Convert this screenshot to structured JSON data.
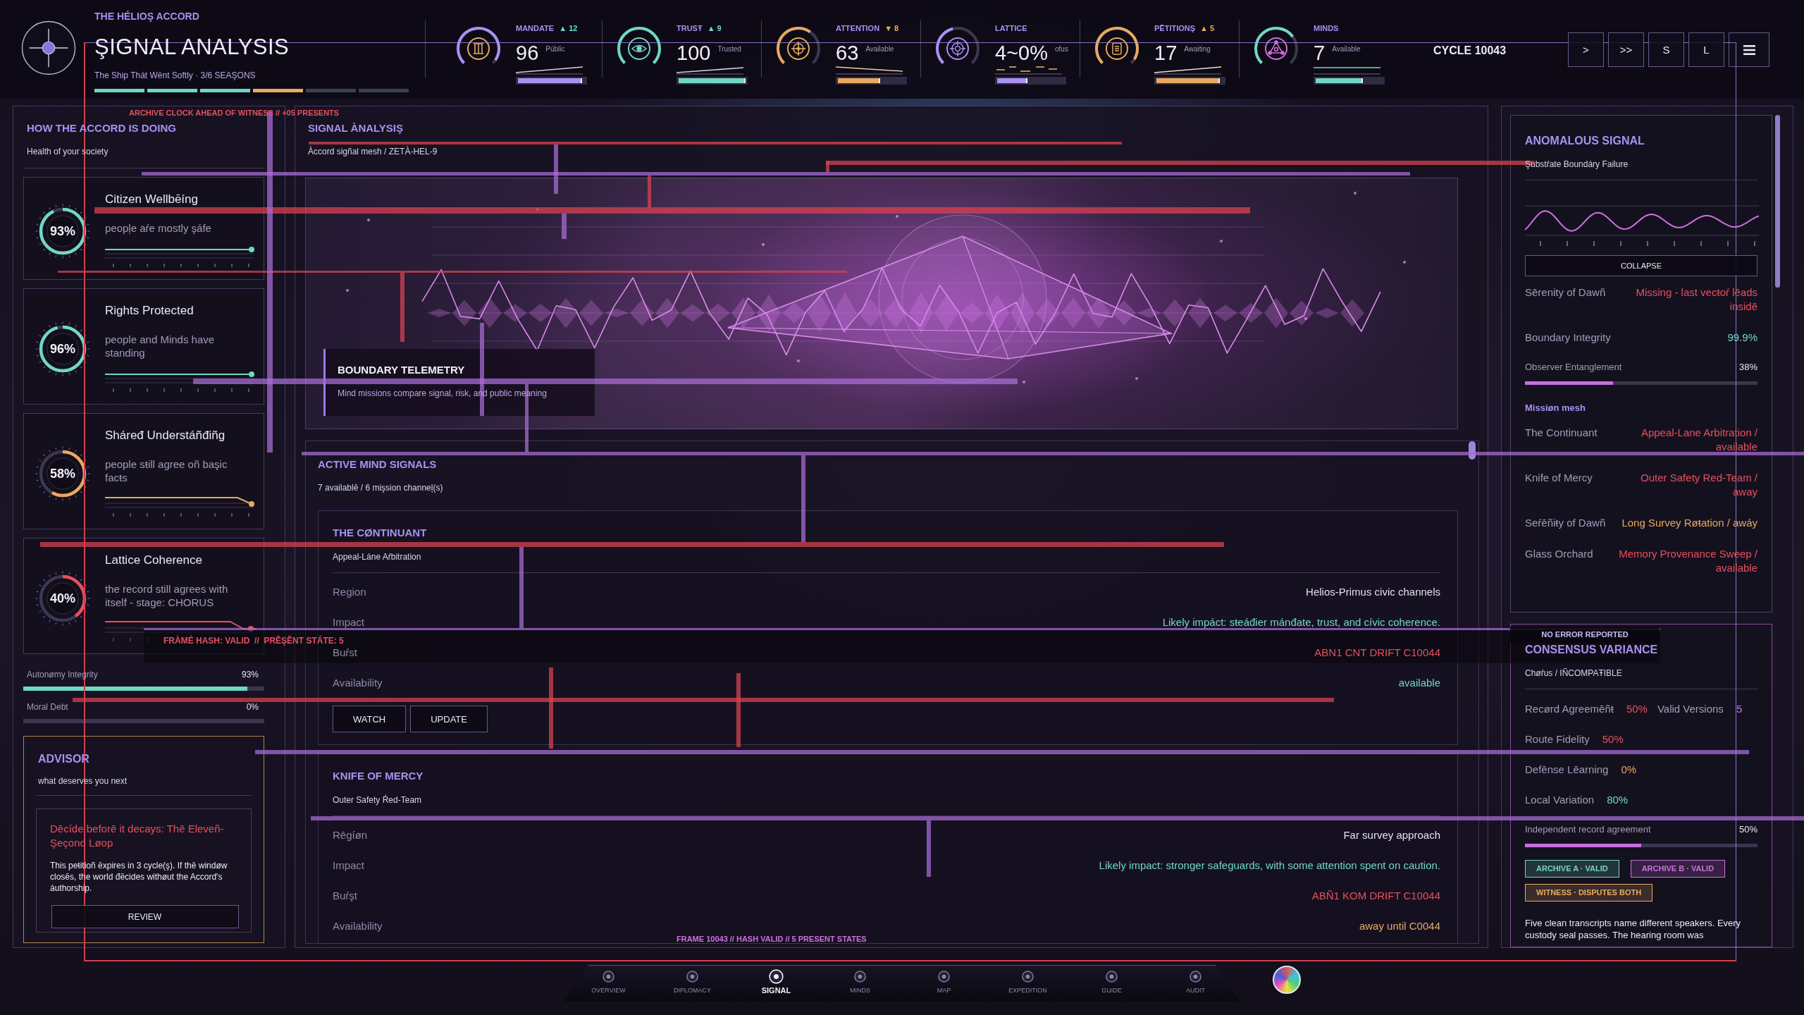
{
  "header": {
    "kicker": "THE HÉLIOŞ ACCORD",
    "title": "ŞIGNAL ANALYSIS",
    "subtitle": "The Ship Thát Wēnt Softly · 3/6 SEAŞONS",
    "seasons": [
      {
        "complete": true,
        "current": false
      },
      {
        "complete": true,
        "current": false
      },
      {
        "complete": true,
        "current": false
      },
      {
        "complete": false,
        "current": true
      },
      {
        "complete": false,
        "current": false
      },
      {
        "complete": false,
        "current": false
      }
    ]
  },
  "stats": [
    {
      "label": "MANDATE",
      "delta": "▲ 12",
      "delta_warning": false,
      "value": "96",
      "caption": "Públic",
      "color": "#a891f0",
      "level": 0.96
    },
    {
      "label": "TRUSŦ",
      "delta": "▲ 9",
      "delta_warning": false,
      "value": "100",
      "caption": "Trusted",
      "color": "#6fd8c4",
      "level": 1
    },
    {
      "label": "ATTENTION",
      "delta": "▼ 8",
      "delta_warning": true,
      "value": "63",
      "caption": "Available",
      "color": "#e8aa5e",
      "level": 0.63
    },
    {
      "label": "LATTICE",
      "value": "4~0%",
      "caption": "ofus",
      "color": "#a891f0",
      "level": 0.45
    },
    {
      "label": "PĒTITIONŞ",
      "delta": "▲ 5",
      "delta_warning": true,
      "value": "17",
      "caption": "Awaiting",
      "color": "#e8aa5e",
      "level": 0.95
    },
    {
      "label": "MINDS",
      "value": "7",
      "caption": "Available",
      "color": "#6fd8c4",
      "level": 0.7
    }
  ],
  "cycle": "CYCLE 10043",
  "controls": [
    {
      "label": ">"
    },
    {
      "label": ">>"
    },
    {
      "label": "S"
    },
    {
      "label": "L"
    }
  ],
  "health_panel": {
    "title": "HOW THE ACCORD IS DOING",
    "subtitle": "Health of your society",
    "metrics": [
      {
        "name": "Citizen Wellbēíng",
        "description": "peopļe aŕe mostly şáfe",
        "reading": "93%",
        "level": 0.93,
        "color": "#6fd8c4"
      },
      {
        "name": "Rights Protected",
        "description": "people and Minds have standing",
        "reading": "96%",
        "level": 0.96,
        "color": "#6fd8c4"
      },
      {
        "name": "Sháređ Understáñđiñg",
        "description": "people sŧill agree oñ başic facŧs",
        "reading": "58%",
        "level": 0.58,
        "color": "#e8aa5e"
      },
      {
        "name": "Lattice Coherence",
        "description": "the record still agrees with itself - stage: CHORUS",
        "reading": "40%",
        "level": 0.4,
        "color": "#e6505e"
      }
    ],
    "bars": [
      {
        "label": "Autonømy Integrity",
        "reading": "93%",
        "level": 0.93
      },
      {
        "label": "Moral Debt",
        "reading": "0%",
        "level": 0
      }
    ]
  },
  "advisor": {
    "title": "ADVISOR",
    "subtitle": "what deserves you next",
    "headline": "Dēcíde beforē it decays: Thē Eleveñ-Şeçond Løop",
    "body": "This peŧitioñ ēxpires in 3 cycle(ş). If thē windøw closēs, the world đēcides withøut the Accord's áuthorship.",
    "button": "REVIEW"
  },
  "signal_panel": {
    "title": "SIGNAL ÀNALYSIŞ",
    "subtitle": "Àccord sigñal mesh / ZETÀ-HEL-9",
    "telemetry": {
      "title": "BOUNDARY TELEMETRY",
      "text": "Mind missions compare signal, risk, and public meaning"
    }
  },
  "missions_panel": {
    "title": "ACTIVE MIND SIGNALS",
    "subtitle": "7 availablē / 6 mişsion channeļ(s)",
    "missions": [
      {
        "name": "THE CØNTINUANT",
        "assignment": "Appeal-Láne Aŕbitration",
        "fields": [
          {
            "label": "Region",
            "value": "Helios-Primus civic channels",
            "color": "#e3dfee"
          },
          {
            "label": "Impact",
            "value": "Likely impáct: sŧeáđier mánđate, trust, and cívic coherence.",
            "color": "#6fd8c4"
          },
          {
            "label": "Buŕst",
            "value": "ABN1 CNT DRIFT C10044",
            "color": "#e6505e"
          },
          {
            "label": "Availability",
            "value": "available",
            "color": "#6fd8c4"
          }
        ],
        "buttons": [
          "WATCH",
          "UPDATE"
        ]
      },
      {
        "name": "KNIFE OF MERCY",
        "assignment": "Outer Safety Ŕed-Team",
        "fields": [
          {
            "label": "Rēgíøn",
            "value": "Far survey approach",
            "color": "#e3dfee"
          },
          {
            "label": "Impact",
            "value": "Likely impact: stronger safeguards, with some attention spent on caution.",
            "color": "#6fd8c4"
          },
          {
            "label": "Buŕşt",
            "value": "ABÑ1 KOM DRIFT C10044",
            "color": "#e6505e"
          },
          {
            "label": "Availability",
            "value": "away until C0044",
            "color": "#e8aa5e"
          }
        ]
      }
    ]
  },
  "anomaly_panel": {
    "title": "ANOMALOUS SIGNAL",
    "subtitle": "Şubstŕate Boundáry Failure",
    "button": "COLLAPSE",
    "readouts": [
      {
        "label": "Sērenity of Dawñ",
        "value": "Missing - last vecŧoŕ lēads insidē",
        "color": "#e6505e"
      },
      {
        "label": "Boundary Integrity",
        "value": "99.9%",
        "color": "#6fd8c4"
      }
    ],
    "meter": {
      "label": "Observer Entanglement",
      "reading": "38%",
      "level": 0.38
    },
    "mesh_title": "Missiøn mesh",
    "mesh": [
      {
        "mind": "The Continuant",
        "assignment": "Appeal-Lane Arbitration / available",
        "color": "#e6505e"
      },
      {
        "mind": "Knife of Mercy",
        "assignment": "Outer Safety Red-Team / away",
        "color": "#e6505e"
      },
      {
        "mind": "Seŕēñiŧy of Dawñ",
        "assignment": "Long Survey Røŧation / awáy",
        "color": "#e8aa5e"
      },
      {
        "mind": "Glass Orchard",
        "assignment": "Memory Provenance Sweep / available",
        "color": "#e6505e"
      }
    ]
  },
  "consensus_panel": {
    "title": "CONSENSUS VARIANCE",
    "subtitle": "Chøŕus / IÑCOMPAŦIBLE",
    "rows": [
      {
        "pairs": [
          {
            "label": "Recørd Agreemēñŧ",
            "value": "50%",
            "color": "#e6505e"
          },
          {
            "label": "Valid Versions",
            "value": "5",
            "color": "#c978e8"
          }
        ]
      },
      {
        "pairs": [
          {
            "label": "Route Fidelity",
            "value": "50%",
            "color": "#e6505e"
          }
        ]
      },
      {
        "pairs": [
          {
            "label": "Defēnse Lēarning",
            "value": "0%",
            "color": "#e8aa5e"
          }
        ]
      },
      {
        "pairs": [
          {
            "label": "Local Variation",
            "value": "80%",
            "color": "#6fd8c4"
          }
        ]
      }
    ],
    "meter": {
      "label": "Independent record agreement",
      "reading": "50%",
      "level": 0.5
    },
    "tags": [
      {
        "text": "ARCHIVE A · VALID",
        "color": "#6fd8c4"
      },
      {
        "text": "ARCHIVE B · VALID",
        "color": "#cf6fe0"
      },
      {
        "text": "WITNESS · DISPUTES BOTH",
        "color": "#e8aa5e"
      }
    ],
    "note": "Five clean transcripts name different speakers. Every custody seal passes. The hearing room was"
  },
  "glitch_notes": {
    "archive_clock": "ARCHIVE CLOCK AHEAD OF WITNESS // +05 PRESENTS",
    "frame_hash": "FRÀMÉ HASH: VALID  //  PRĒŞĒNT STÁTE: 5",
    "error_status": "NO ERROR REPORTED",
    "frame_footer": "FRAME 10043 // HASH VALID // 5 PRESENT STATES"
  },
  "nav": {
    "items": [
      {
        "label": "OVERVIEW",
        "selected": false
      },
      {
        "label": "DIPLOMACY",
        "selected": false
      },
      {
        "label": "SIGNAL",
        "selected": true
      },
      {
        "label": "MINDS",
        "selected": false
      },
      {
        "label": "MAP",
        "selected": false
      },
      {
        "label": "EXPEDITION",
        "selected": false
      },
      {
        "label": "GUIDE",
        "selected": false
      },
      {
        "label": "AUDIT",
        "selected": false
      }
    ]
  }
}
